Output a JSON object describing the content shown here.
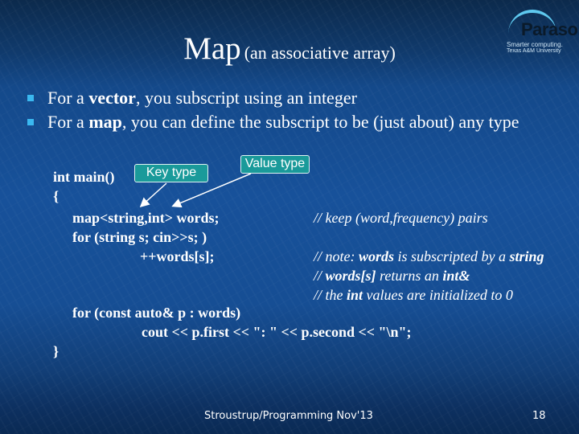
{
  "title": {
    "main": "Map",
    "subtitle": "(an associative array)"
  },
  "logo": {
    "name": "Parasol",
    "tagline1": "Smarter computing.",
    "tagline2": "Texas A&M University"
  },
  "bullets": [
    {
      "pre": "For a ",
      "bold": "vector",
      "post": ", you subscript using an integer"
    },
    {
      "pre": "For a ",
      "bold": "map",
      "post": ", you can define the subscript to be (just about) any type"
    }
  ],
  "callouts": {
    "key_type": "Key type",
    "value_type": "Value type"
  },
  "code": {
    "line1": "int main()",
    "line2": "{",
    "line3": "map<string,int> words;",
    "line4": "for (string s; cin>>s; )",
    "line5": "++words[s];",
    "line6": "for (const auto&  p : words)",
    "line7": "cout << p.first << \": \" << p.second << \"\\n\";",
    "line8": "}"
  },
  "comments": {
    "c1": "// keep (word,frequency) pairs",
    "c2": {
      "a": "// note: ",
      "b": "words",
      "c": " is subscripted by a ",
      "d": "string"
    },
    "c3": {
      "a": "// ",
      "b": "words[s]",
      "c": " returns an ",
      "d": "int&"
    },
    "c4": {
      "a": "// the ",
      "b": "int",
      "c": " values are initialized to 0"
    }
  },
  "footer": {
    "text": "Stroustrup/Programming Nov'13",
    "page": "18"
  },
  "colors": {
    "bullet": "#3ab8f0",
    "callout": "#1a9a9a",
    "background": "#17519a"
  }
}
